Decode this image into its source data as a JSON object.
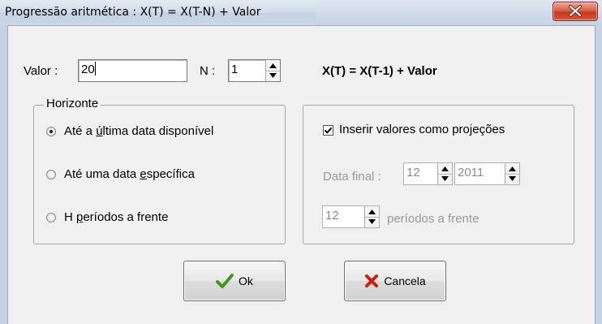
{
  "window": {
    "title": "Progressão aritmética : X(T) = X(T-N) + Valor"
  },
  "form": {
    "valor_label": "Valor :",
    "valor_value": "20",
    "n_label": "N :",
    "n_value": "1",
    "formula": "X(T) = X(T-1) + Valor"
  },
  "horizonte": {
    "label": "Horizonte",
    "options": [
      {
        "pre": "Até a ",
        "accel": "ú",
        "post": "ltima data disponível",
        "selected": true
      },
      {
        "pre": "Até uma data ",
        "accel": "e",
        "post": "specífica",
        "selected": false
      },
      {
        "pre": "H ",
        "accel": "p",
        "post": "eríodos a frente",
        "selected": false
      }
    ]
  },
  "projecoes": {
    "checkbox_label": "Inserir valores como projeções",
    "checked": true,
    "data_final_label": "Data final :",
    "month_value": "12",
    "year_value": "2011",
    "periods_value": "12",
    "periods_label": "períodos a frente"
  },
  "buttons": {
    "ok_label": "Ok",
    "cancel_label": "Cancela"
  },
  "colors": {
    "ok_check": "#3a9a1c",
    "cancel_x": "#c8200e",
    "close_button": "#c7381f"
  }
}
